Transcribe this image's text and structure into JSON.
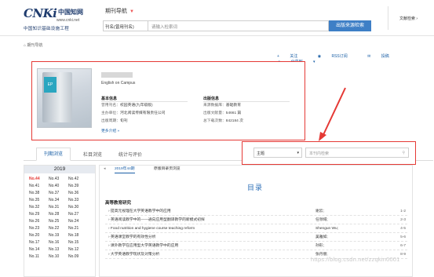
{
  "header": {
    "logo_mark": "CNKi",
    "logo_cn": "中国知网",
    "logo_url": "www.cnki.net",
    "logo_tagline": "中国知识基础设施工程",
    "nav_title": "期刊导航",
    "search_select": "刊名(曾用刊名)",
    "search_placeholder": "请输入检索词",
    "search_button": "出版来源检索",
    "literature_search": "文献检索"
  },
  "breadcrumb": "期刊导航",
  "actions": [
    "关注",
    "RSS订阅",
    "投稿",
    "分享到"
  ],
  "journal": {
    "english_name": "English on Campus",
    "basic_info_heading": "基本信息",
    "publish_info_heading": "出版信息",
    "basic_info": [
      {
        "label": "曾用刊名：",
        "value": "校园英语(九年级版)"
      },
      {
        "label": "主办单位：",
        "value": "河北阅读传媒有限责任公司"
      },
      {
        "label": "出版周期：",
        "value": "旬刊"
      }
    ],
    "publish_info": [
      {
        "label": "来源数据库：",
        "value": "基础教育"
      },
      {
        "label": "出版文献量：",
        "value": "54661 篇"
      },
      {
        "label": "总下载次数：",
        "value": "842184 次"
      }
    ],
    "more_link": "更多介绍"
  },
  "tabs": [
    "刊期浏览",
    "栏目浏览",
    "统计与评价"
  ],
  "filter": {
    "select_value": "主题",
    "placeholder": "本刊内检索"
  },
  "year_panel": {
    "year": "2019",
    "issues": [
      [
        "No.44",
        "No.43",
        "No.42"
      ],
      [
        "No.41",
        "No.40",
        "No.39"
      ],
      [
        "No.38",
        "No.37",
        "No.36"
      ],
      [
        "No.35",
        "No.34",
        "No.33"
      ],
      [
        "No.32",
        "No.31",
        "No.30"
      ],
      [
        "No.29",
        "No.28",
        "No.27"
      ],
      [
        "No.26",
        "No.25",
        "No.24"
      ],
      [
        "No.23",
        "No.22",
        "No.21"
      ],
      [
        "No.20",
        "No.19",
        "No.18"
      ],
      [
        "No.17",
        "No.16",
        "No.15"
      ],
      [
        "No.14",
        "No.13",
        "No.12"
      ],
      [
        "No.11",
        "No.10",
        "No.09"
      ]
    ],
    "current_issue": "No.44"
  },
  "issue_tabs": [
    "2019年44期",
    "原版目录页浏览"
  ],
  "toc": {
    "title": "目录",
    "section": "高等教育研究",
    "articles": [
      {
        "title": "提高元视理在大学英语教学中的应用",
        "author": "谢云;",
        "pages": "1-2"
      },
      {
        "title": "英语阅读教学中的——通向应用型翻译教学的新模式初探",
        "author": "任领域;",
        "pages": "2-3"
      },
      {
        "title": "Food nutrition and hygiene course teaching reform",
        "author": "Shengun Wu;",
        "pages": "4-5"
      },
      {
        "title": "英语课堂教学的有效性分析",
        "author": "吴雅如;",
        "pages": "5-6"
      },
      {
        "title": "课外教学在应用型大学英语教学中的应用",
        "author": "孙形;",
        "pages": "6-7"
      },
      {
        "title": "大学英语教学现状及对策分析",
        "author": "张丹丽;",
        "pages": "8-9"
      }
    ]
  },
  "watermark": "https://blog.csdn.net/zzqkin0001"
}
